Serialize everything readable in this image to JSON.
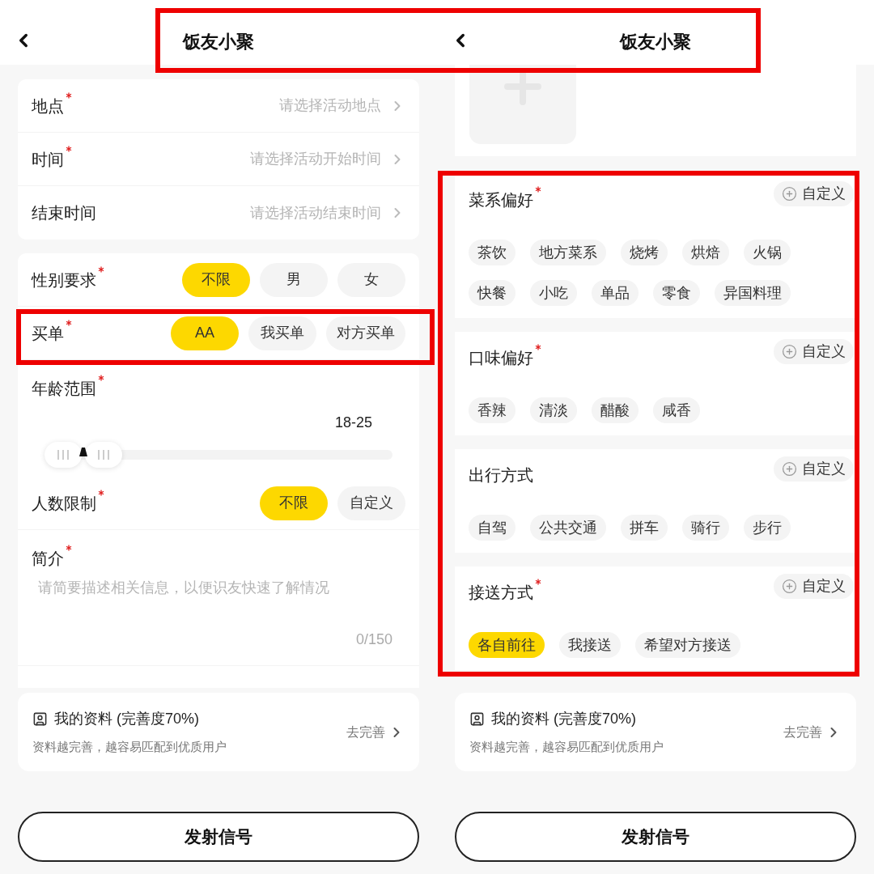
{
  "title_highlight": true,
  "screens": [
    {
      "kind": "form",
      "header": {
        "title": "饭友小聚"
      },
      "rows": [
        {
          "label": "地点",
          "required": true,
          "placeholder": "请选择活动地点"
        },
        {
          "label": "时间",
          "required": true,
          "placeholder": "请选择活动开始时间"
        },
        {
          "label": "结束时间",
          "required": false,
          "placeholder": "请选择活动结束时间"
        }
      ],
      "fields": [
        {
          "kind": "choice",
          "label": "性别要求",
          "required": true,
          "highlighted": false,
          "options": [
            {
              "label": "不限",
              "selected": true
            },
            {
              "label": "男",
              "selected": false
            },
            {
              "label": "女",
              "selected": false
            }
          ]
        },
        {
          "kind": "choice",
          "label": "买单",
          "required": true,
          "highlighted": true,
          "options": [
            {
              "label": "AA",
              "selected": true
            },
            {
              "label": "我买单",
              "selected": false
            },
            {
              "label": "对方买单",
              "selected": false
            }
          ]
        },
        {
          "kind": "range",
          "label": "年龄范围",
          "required": true,
          "reading": "18-25",
          "thumbs": [
            {
              "level": 0
            },
            {
              "level": 0.13
            }
          ]
        },
        {
          "kind": "choice",
          "label": "人数限制",
          "required": true,
          "highlighted": false,
          "options": [
            {
              "label": "不限",
              "selected": true
            },
            {
              "label": "自定义",
              "selected": false
            }
          ]
        },
        {
          "kind": "textarea",
          "label": "简介",
          "required": true,
          "placeholder": "请简要描述相关信息，以便识友快速了解情况",
          "counter": "0/150"
        }
      ],
      "profile": {
        "title": "我的资料 (完善度70%)",
        "subtitle": "资料越完善，越容易匹配到优质用户",
        "action": "去完善"
      },
      "submit": "发射信号"
    },
    {
      "kind": "preferences",
      "header": {
        "title": "饭友小聚"
      },
      "highlighted": true,
      "groups": [
        {
          "label": "菜系偏好",
          "required": true,
          "custom": "自定义",
          "tags": [
            {
              "label": "茶饮",
              "selected": false
            },
            {
              "label": "地方菜系",
              "selected": false
            },
            {
              "label": "烧烤",
              "selected": false
            },
            {
              "label": "烘焙",
              "selected": false
            },
            {
              "label": "火锅",
              "selected": false
            },
            {
              "label": "快餐",
              "selected": false
            },
            {
              "label": "小吃",
              "selected": false
            },
            {
              "label": "单品",
              "selected": false
            },
            {
              "label": "零食",
              "selected": false
            },
            {
              "label": "异国料理",
              "selected": false
            }
          ]
        },
        {
          "label": "口味偏好",
          "required": true,
          "custom": "自定义",
          "tags": [
            {
              "label": "香辣",
              "selected": false
            },
            {
              "label": "清淡",
              "selected": false
            },
            {
              "label": "醋酸",
              "selected": false
            },
            {
              "label": "咸香",
              "selected": false
            }
          ]
        },
        {
          "label": "出行方式",
          "required": false,
          "custom": "自定义",
          "tags": [
            {
              "label": "自驾",
              "selected": false
            },
            {
              "label": "公共交通",
              "selected": false
            },
            {
              "label": "拼车",
              "selected": false
            },
            {
              "label": "骑行",
              "selected": false
            },
            {
              "label": "步行",
              "selected": false
            }
          ]
        },
        {
          "label": "接送方式",
          "required": true,
          "custom": "自定义",
          "tags": [
            {
              "label": "各自前往",
              "selected": true
            },
            {
              "label": "我接送",
              "selected": false
            },
            {
              "label": "希望对方接送",
              "selected": false
            }
          ]
        }
      ],
      "profile": {
        "title": "我的资料 (完善度70%)",
        "subtitle": "资料越完善，越容易匹配到优质用户",
        "action": "去完善"
      },
      "submit": "发射信号"
    }
  ]
}
